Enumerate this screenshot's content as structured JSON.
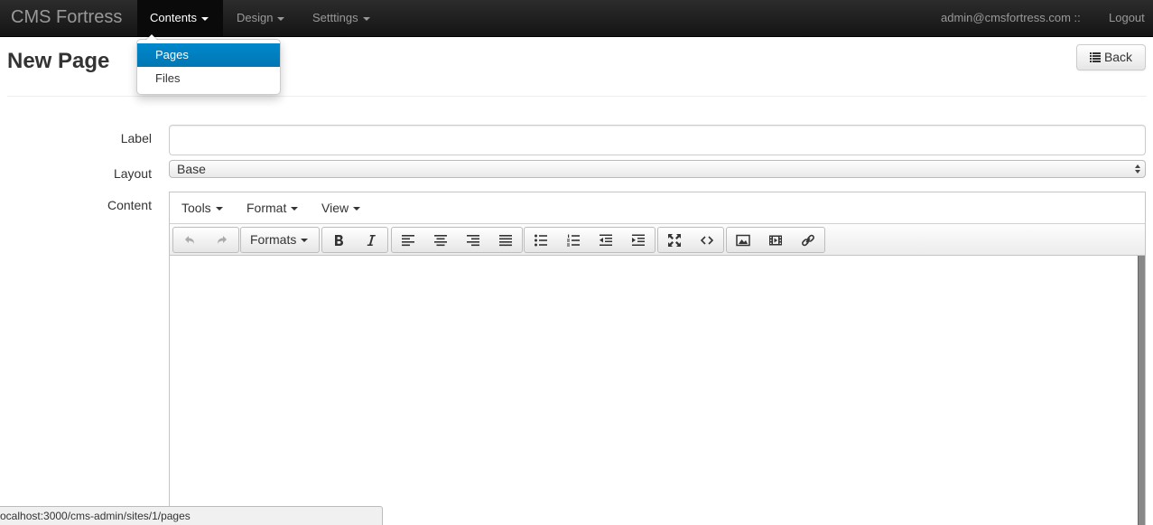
{
  "navbar": {
    "brand": "CMS Fortress",
    "menus": [
      {
        "label": "Contents"
      },
      {
        "label": "Design"
      },
      {
        "label": "Setttings"
      }
    ],
    "user": "admin@cmsfortress.com ::",
    "logout": "Logout"
  },
  "dropdown": {
    "items": [
      {
        "label": "Pages"
      },
      {
        "label": "Files"
      }
    ]
  },
  "header": {
    "title": "New Page",
    "back_label": "Back"
  },
  "form": {
    "label_label": "Label",
    "label_value": "",
    "layout_label": "Layout",
    "layout_value": "Base",
    "content_label": "Content"
  },
  "editor": {
    "menus": [
      {
        "label": "Tools"
      },
      {
        "label": "Format"
      },
      {
        "label": "View"
      }
    ],
    "formats_label": "Formats"
  },
  "status_bar": {
    "url": "ocalhost:3000/cms-admin/sites/1/pages"
  },
  "colors": {
    "navbar_bg": "#1b1b1b",
    "dropdown_selected": "#0081c2"
  }
}
